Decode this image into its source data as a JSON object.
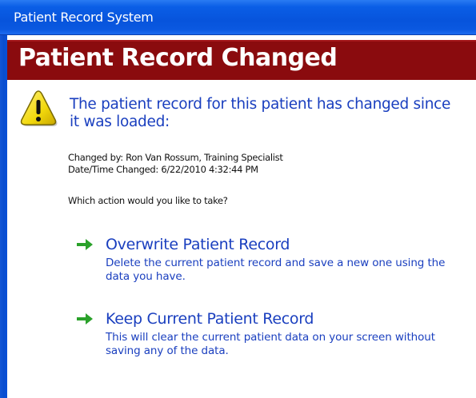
{
  "window": {
    "title": "Patient Record System"
  },
  "banner": {
    "title": "Patient Record Changed"
  },
  "message": {
    "icon": "warning-icon",
    "headline": "The patient record for this patient has changed since it was loaded:",
    "changed_by": "Changed by: Ron Van Rossum, Training Specialist",
    "changed_at": "Date/Time Changed: 6/22/2010 4:32:44 PM",
    "question": "Which action would you like to take?"
  },
  "options": [
    {
      "icon": "green-arrow-icon",
      "title": "Overwrite Patient Record",
      "description": "Delete the current patient record and save a new one using the data you have."
    },
    {
      "icon": "green-arrow-icon",
      "title": "Keep Current Patient Record",
      "description": "This will clear the current patient data on your screen without saving any of the data."
    }
  ],
  "colors": {
    "titlebar": "#0754dc",
    "banner": "#8a0b0e",
    "link_text": "#1a3fbf",
    "arrow": "#2aa12a",
    "warning_fill": "#f6e21a"
  }
}
